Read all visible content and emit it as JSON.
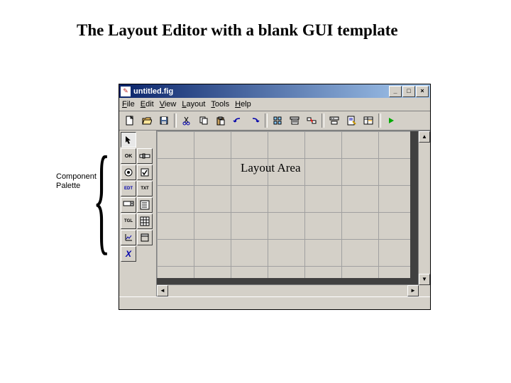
{
  "caption": "The Layout Editor with a blank GUI template",
  "side_label_line1": "Component",
  "side_label_line2": "Palette",
  "window": {
    "title": "untitled.fig",
    "min": "_",
    "max": "□",
    "close": "×"
  },
  "menu": {
    "file": "File",
    "edit": "Edit",
    "view": "View",
    "layout": "Layout",
    "tools": "Tools",
    "help": "Help"
  },
  "toolbar": {
    "new": "new",
    "open": "open",
    "save": "save",
    "cut": "cut",
    "copy": "copy",
    "paste": "paste",
    "undo": "undo",
    "redo": "redo",
    "align": "align",
    "menu_ed": "menu",
    "tab": "tab",
    "tool": "tool",
    "editor": "editor",
    "obj": "obj",
    "run": "run"
  },
  "palette": {
    "select": "↖",
    "pushbutton": "OK",
    "slider": "▭",
    "radio": "◉",
    "checkbox": "☑",
    "edit": "EDT",
    "text": "TXT",
    "popup": "▾",
    "listbox": "≡",
    "toggle": "TGL",
    "table": "▦",
    "axes": "⊞",
    "panel": "▭",
    "activex": "X"
  },
  "layout_area_label": "Layout Area"
}
